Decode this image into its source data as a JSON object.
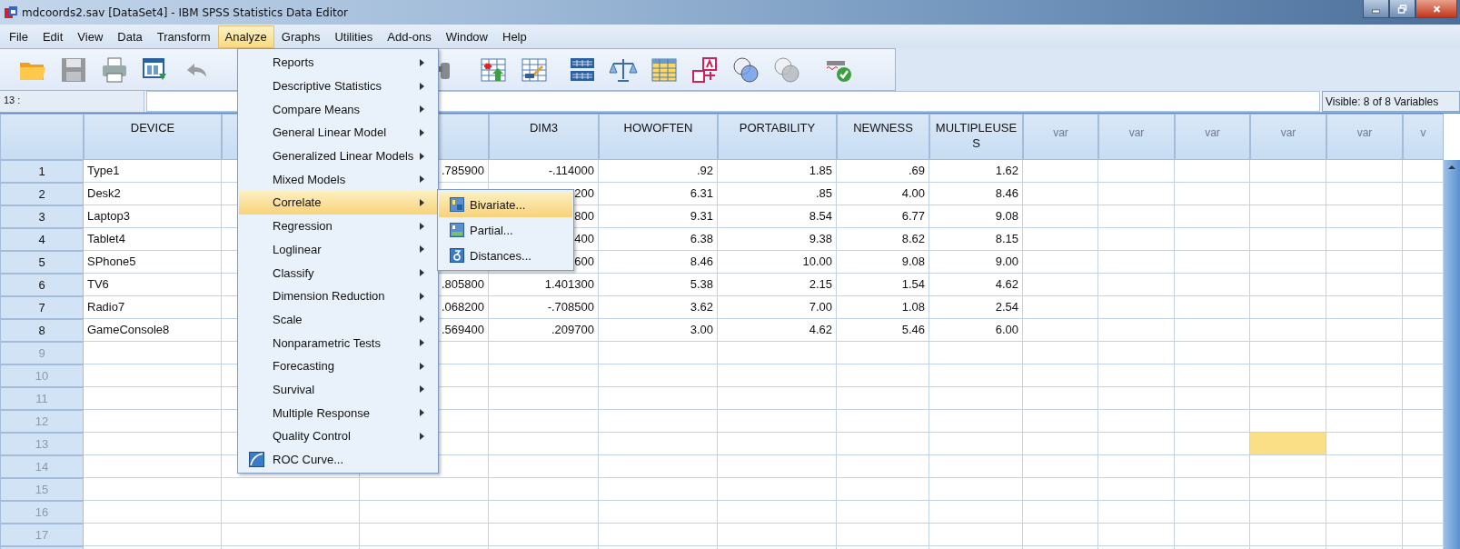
{
  "window": {
    "title": "mdcoords2.sav [DataSet4] - IBM SPSS Statistics Data Editor"
  },
  "menu_bar": [
    {
      "label": "File",
      "selected": false
    },
    {
      "label": "Edit",
      "selected": false
    },
    {
      "label": "View",
      "selected": false
    },
    {
      "label": "Data",
      "selected": false
    },
    {
      "label": "Transform",
      "selected": false
    },
    {
      "label": "Analyze",
      "selected": true
    },
    {
      "label": "Graphs",
      "selected": false
    },
    {
      "label": "Utilities",
      "selected": false
    },
    {
      "label": "Add-ons",
      "selected": false
    },
    {
      "label": "Window",
      "selected": false
    },
    {
      "label": "Help",
      "selected": false
    }
  ],
  "toolbar": [
    {
      "kind": "open",
      "disabled": false
    },
    {
      "kind": "save",
      "disabled": true
    },
    {
      "kind": "print",
      "disabled": false
    },
    {
      "kind": "dialog",
      "disabled": false
    },
    {
      "kind": "undo",
      "disabled": true
    },
    {
      "kind": "find",
      "disabled": true
    },
    {
      "kind": "insert_cases",
      "disabled": false
    },
    {
      "kind": "insert_variable",
      "disabled": false
    },
    {
      "kind": "split",
      "disabled": false
    },
    {
      "kind": "weight",
      "disabled": false
    },
    {
      "kind": "select",
      "disabled": false
    },
    {
      "kind": "labels",
      "disabled": false
    },
    {
      "kind": "sets",
      "disabled": false
    },
    {
      "kind": "sets",
      "disabled": true
    },
    {
      "kind": "spelling",
      "disabled": false
    }
  ],
  "cell_reference": "13 :",
  "visible_variables": "Visible: 8 of 8 Variables",
  "table": {
    "columns": [
      {
        "label": "DEVICE",
        "kind": "string"
      },
      {
        "kind": "hidden"
      },
      {
        "kind": "hidden"
      },
      {
        "label": "DIM3",
        "kind": "numeric"
      },
      {
        "label": "HOWOFTEN",
        "kind": "numeric"
      },
      {
        "label": "PORTABILITY",
        "kind": "numeric"
      },
      {
        "label": "NEWNESS",
        "kind": "numeric"
      },
      {
        "label": "MULTIPLEUSES",
        "kind": "numeric"
      },
      {
        "label": "var",
        "kind": "empty"
      },
      {
        "label": "var",
        "kind": "empty"
      },
      {
        "label": "var",
        "kind": "empty"
      },
      {
        "label": "var",
        "kind": "empty"
      },
      {
        "label": "var",
        "kind": "empty"
      },
      {
        "label": "v",
        "kind": "empty"
      }
    ],
    "rows": [
      {
        "number": "1",
        "dimmed": false,
        "cells": [
          "Type1",
          null,
          ".785900",
          "-.114000",
          ".92",
          "1.85",
          ".69",
          "1.62"
        ]
      },
      {
        "number": "2",
        "dimmed": false,
        "cells": [
          "Desk2",
          null,
          null,
          "200",
          "6.31",
          ".85",
          "4.00",
          "8.46"
        ]
      },
      {
        "number": "3",
        "dimmed": false,
        "cells": [
          "Laptop3",
          null,
          null,
          "800",
          "9.31",
          "8.54",
          "6.77",
          "9.08"
        ]
      },
      {
        "number": "4",
        "dimmed": false,
        "cells": [
          "Tablet4",
          null,
          null,
          "400",
          "6.38",
          "9.38",
          "8.62",
          "8.15"
        ]
      },
      {
        "number": "5",
        "dimmed": false,
        "cells": [
          "SPhone5",
          null,
          null,
          "600",
          "8.46",
          "10.00",
          "9.08",
          "9.00"
        ]
      },
      {
        "number": "6",
        "dimmed": false,
        "cells": [
          "TV6",
          null,
          ".805800",
          "1.401300",
          "5.38",
          "2.15",
          "1.54",
          "4.62"
        ]
      },
      {
        "number": "7",
        "dimmed": false,
        "cells": [
          "Radio7",
          null,
          ".068200",
          "-.708500",
          "3.62",
          "7.00",
          "1.08",
          "2.54"
        ]
      },
      {
        "number": "8",
        "dimmed": false,
        "cells": [
          "GameConsole8",
          null,
          ".569400",
          ".209700",
          "3.00",
          "4.62",
          "5.46",
          "6.00"
        ]
      },
      {
        "number": "9",
        "dimmed": true
      },
      {
        "number": "10",
        "dimmed": true
      },
      {
        "number": "11",
        "dimmed": true
      },
      {
        "number": "12",
        "dimmed": true
      },
      {
        "number": "13",
        "dimmed": true,
        "cells": [
          null,
          null,
          null,
          null,
          null,
          null,
          null,
          null,
          null,
          null,
          null,
          {
            "selected": true
          }
        ]
      },
      {
        "number": "14",
        "dimmed": true
      },
      {
        "number": "15",
        "dimmed": true
      },
      {
        "number": "16",
        "dimmed": true
      },
      {
        "number": "17",
        "dimmed": true
      }
    ]
  },
  "analyze_menu": {
    "items": [
      {
        "label": "Reports",
        "kind": "submenu",
        "selected": false
      },
      {
        "label": "Descriptive Statistics",
        "kind": "submenu",
        "selected": false
      },
      {
        "label": "Compare Means",
        "kind": "submenu",
        "selected": false
      },
      {
        "label": "General Linear Model",
        "kind": "submenu",
        "selected": false
      },
      {
        "label": "Generalized Linear Models",
        "kind": "submenu",
        "selected": false
      },
      {
        "label": "Mixed Models",
        "kind": "submenu",
        "selected": false
      },
      {
        "label": "Correlate",
        "kind": "submenu",
        "selected": true
      },
      {
        "label": "Regression",
        "kind": "submenu",
        "selected": false
      },
      {
        "label": "Loglinear",
        "kind": "submenu",
        "selected": false
      },
      {
        "label": "Classify",
        "kind": "submenu",
        "selected": false
      },
      {
        "label": "Dimension Reduction",
        "kind": "submenu",
        "selected": false
      },
      {
        "label": "Scale",
        "kind": "submenu",
        "selected": false
      },
      {
        "label": "Nonparametric Tests",
        "kind": "submenu",
        "selected": false
      },
      {
        "label": "Forecasting",
        "kind": "submenu",
        "selected": false
      },
      {
        "label": "Survival",
        "kind": "submenu",
        "selected": false
      },
      {
        "label": "Multiple Response",
        "kind": "submenu",
        "selected": false
      },
      {
        "label": "Quality Control",
        "kind": "submenu",
        "selected": false
      },
      {
        "label": "ROC Curve...",
        "kind": "command",
        "selected": false
      }
    ]
  },
  "correlate_submenu": {
    "items": [
      {
        "label": "Bivariate...",
        "selected": true
      },
      {
        "label": "Partial...",
        "selected": false
      },
      {
        "label": "Distances...",
        "selected": false
      }
    ]
  }
}
